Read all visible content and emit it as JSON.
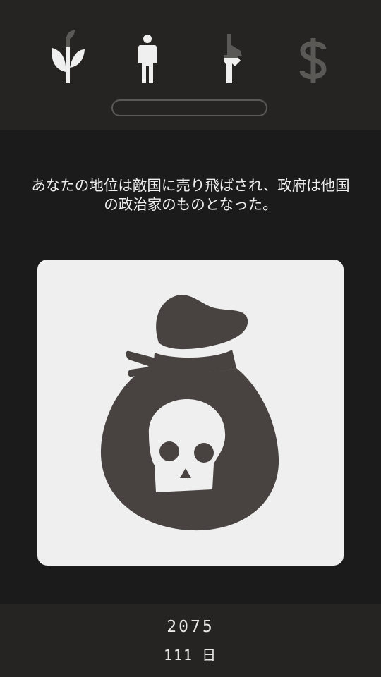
{
  "stats": [
    {
      "name": "religion",
      "icon": "plant-icon",
      "level": 0.5
    },
    {
      "name": "people",
      "icon": "person-icon",
      "level": 1.0
    },
    {
      "name": "army",
      "icon": "rifle-icon",
      "level": 0.5
    },
    {
      "name": "money",
      "icon": "dollar-icon",
      "level": 0.0
    }
  ],
  "progress": {
    "value": 0
  },
  "message": "あなたの地位は敵国に売り飛ばされ、政府は他国の政治家のものとなった。",
  "card": {
    "icon": "skull-money-bag-icon"
  },
  "footer": {
    "year": "2075",
    "days_value": "111",
    "days_unit": "日"
  },
  "colors": {
    "background": "#1b1b1b",
    "bar": "#262422",
    "stat_full": "#efefef",
    "stat_empty": "#5b5956",
    "card": "#efefef",
    "icon": "#484240"
  }
}
